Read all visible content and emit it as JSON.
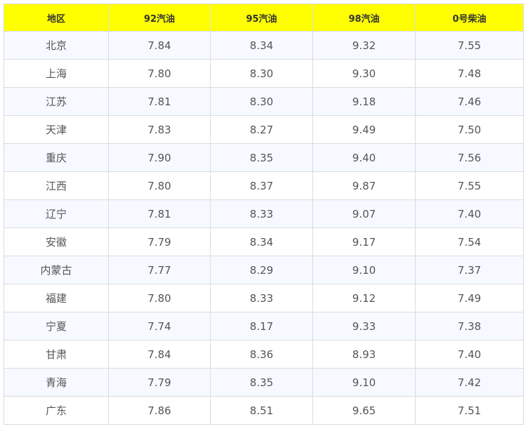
{
  "table": {
    "headers": [
      "地区",
      "92汽油",
      "95汽油",
      "98汽油",
      "0号柴油"
    ],
    "rows": [
      [
        "北京",
        "7.84",
        "8.34",
        "9.32",
        "7.55"
      ],
      [
        "上海",
        "7.80",
        "8.30",
        "9.30",
        "7.48"
      ],
      [
        "江苏",
        "7.81",
        "8.30",
        "9.18",
        "7.46"
      ],
      [
        "天津",
        "7.83",
        "8.27",
        "9.49",
        "7.50"
      ],
      [
        "重庆",
        "7.90",
        "8.35",
        "9.40",
        "7.56"
      ],
      [
        "江西",
        "7.80",
        "8.37",
        "9.87",
        "7.55"
      ],
      [
        "辽宁",
        "7.81",
        "8.33",
        "9.07",
        "7.40"
      ],
      [
        "安徽",
        "7.79",
        "8.34",
        "9.17",
        "7.54"
      ],
      [
        "内蒙古",
        "7.77",
        "8.29",
        "9.10",
        "7.37"
      ],
      [
        "福建",
        "7.80",
        "8.33",
        "9.12",
        "7.49"
      ],
      [
        "宁夏",
        "7.74",
        "8.17",
        "9.33",
        "7.38"
      ],
      [
        "甘肃",
        "7.84",
        "8.36",
        "8.93",
        "7.40"
      ],
      [
        "青海",
        "7.79",
        "8.35",
        "9.10",
        "7.42"
      ],
      [
        "广东",
        "7.86",
        "8.51",
        "9.65",
        "7.51"
      ]
    ]
  },
  "colors": {
    "header_bg": "#ffff00",
    "row_alt_bg": "#f6f9ff",
    "border": "#dcdcdc"
  }
}
